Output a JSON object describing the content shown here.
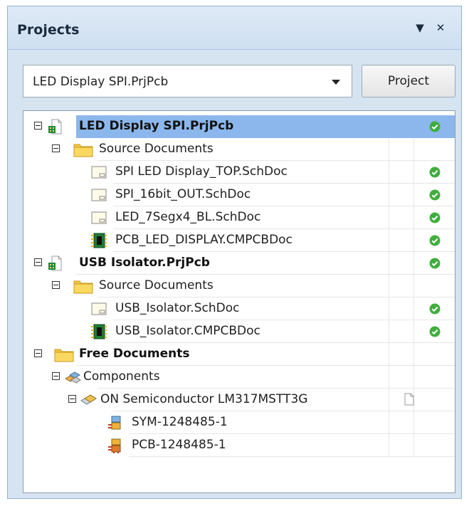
{
  "panel": {
    "title": "Projects",
    "menu_glyph": "▼",
    "close_glyph": "✕"
  },
  "toolbar": {
    "project_select_value": "LED Display SPI.PrjPcb",
    "project_button_label": "Project"
  },
  "tree": {
    "project1": {
      "name": "LED Display SPI.PrjPcb",
      "folder": "Source Documents",
      "docs": [
        "SPI LED Display_TOP.SchDoc",
        "SPI_16bit_OUT.SchDoc",
        "LED_7Segx4_BL.SchDoc",
        "PCB_LED_DISPLAY.CMPCBDoc"
      ]
    },
    "project2": {
      "name": "USB Isolator.PrjPcb",
      "folder": "Source Documents",
      "docs": [
        "USB_Isolator.SchDoc",
        "USB_Isolator.CMPCBDoc"
      ]
    },
    "free": {
      "name": "Free Documents",
      "components_folder": "Components",
      "component": "ON Semiconductor LM317MSTT3G",
      "models": [
        "SYM-1248485-1",
        "PCB-1248485-1"
      ]
    }
  },
  "icons": {
    "status_ok": "green-check-circle-icon",
    "project": "pcb-project-icon",
    "folder": "folder-icon",
    "schematic": "schematic-doc-icon",
    "pcb": "pcb-doc-icon",
    "components": "components-icon",
    "component": "component-icon",
    "symbol": "symbol-model-icon",
    "footprint": "footprint-model-icon",
    "document": "blank-document-icon"
  },
  "colors": {
    "selection": "#8cb7ec",
    "status_green": "#3fae3c",
    "folder_yellow": "#f5c542",
    "panel_bg": "#d6e4f2"
  }
}
